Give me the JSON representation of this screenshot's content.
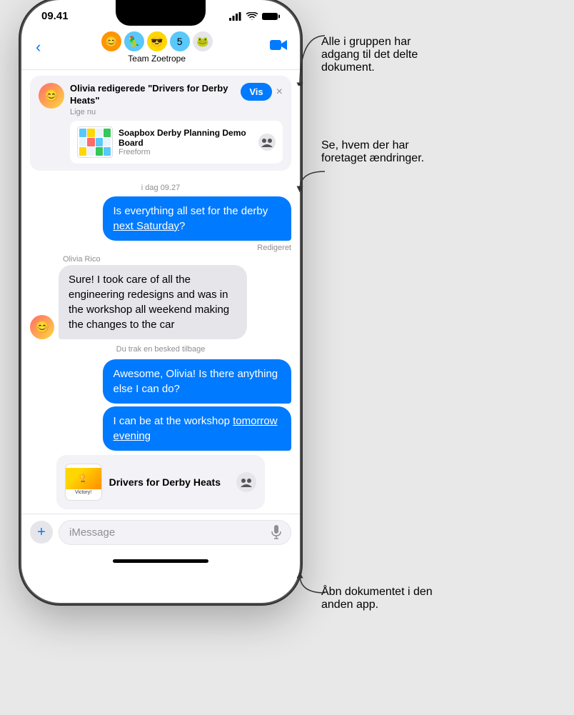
{
  "status_bar": {
    "time": "09.41",
    "signal": "●●●●",
    "wifi": "wifi",
    "battery": "battery"
  },
  "nav": {
    "back_label": "‹",
    "group_name": "Team Zoetrope",
    "video_icon": "📹"
  },
  "notification": {
    "title": "Olivia redigerede \"Drivers for Derby Heats\"",
    "time": "Lige nu",
    "card_title": "Soapbox Derby Planning Demo Board",
    "card_sub": "Freeform",
    "vis_btn": "Vis",
    "close_btn": "×"
  },
  "messages": {
    "timestamp": "i dag 09.27",
    "msg1": {
      "text": "Is everything all set for the derby next Saturday?",
      "link_text": "next Saturday",
      "edited": "Redigeret",
      "type": "sent"
    },
    "msg2": {
      "sender": "Olivia Rico",
      "text": "Sure! I took care of all the engineering redesigns and was in the workshop all weekend making the changes to the car",
      "type": "received"
    },
    "retracted": "Du trak en besked tilbage",
    "msg3": {
      "text": "Awesome, Olivia! Is there anything else I can do?",
      "type": "sent"
    },
    "msg4": {
      "text": "I can be at the workshop tomorrow evening",
      "link_text": "tomorrow evening",
      "type": "sent"
    },
    "doc_card": {
      "title": "Drivers for Derby Heats",
      "type": "received"
    }
  },
  "input_bar": {
    "placeholder": "iMessage",
    "plus_label": "+",
    "mic_label": "🎤"
  },
  "annotations": {
    "ann1": "Alle i gruppen har adgang til det delte dokument.",
    "ann2": "Se, hvem der har foretaget ændringer.",
    "ann3": "Åbn dokumentet i den anden app."
  }
}
